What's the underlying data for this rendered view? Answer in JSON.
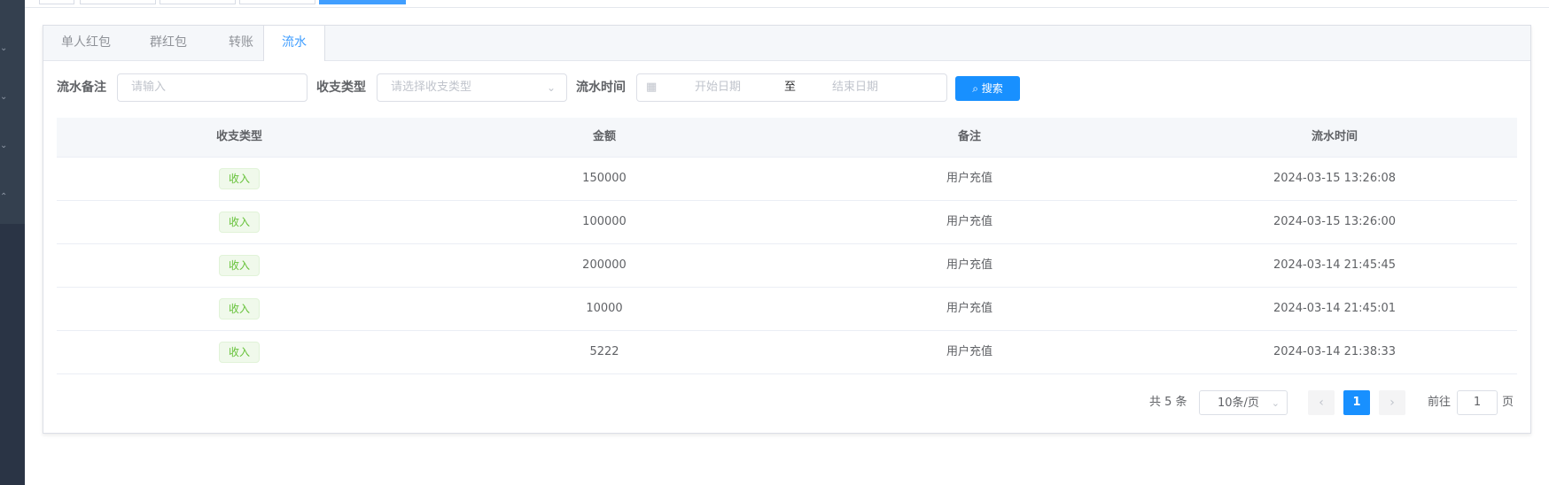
{
  "tabs": [
    "单人红包",
    "群红包",
    "转账",
    "流水"
  ],
  "filters": {
    "remark_label": "流水备注",
    "remark_placeholder": "请输入",
    "type_label": "收支类型",
    "type_placeholder": "请选择收支类型",
    "time_label": "流水时间",
    "start_placeholder": "开始日期",
    "range_separator": "至",
    "end_placeholder": "结束日期",
    "search_label": "搜索"
  },
  "table": {
    "columns": [
      "收支类型",
      "金额",
      "备注",
      "流水时间"
    ],
    "rows": [
      {
        "type": "收入",
        "amount": "150000",
        "remark": "用户充值",
        "time": "2024-03-15 13:26:08"
      },
      {
        "type": "收入",
        "amount": "100000",
        "remark": "用户充值",
        "time": "2024-03-15 13:26:00"
      },
      {
        "type": "收入",
        "amount": "200000",
        "remark": "用户充值",
        "time": "2024-03-14 21:45:45"
      },
      {
        "type": "收入",
        "amount": "10000",
        "remark": "用户充值",
        "time": "2024-03-14 21:45:01"
      },
      {
        "type": "收入",
        "amount": "5222",
        "remark": "用户充值",
        "time": "2024-03-14 21:38:33"
      }
    ]
  },
  "pagination": {
    "total": "共 5 条",
    "page_size": "10条/页",
    "current_page": "1",
    "goto_label": "前往",
    "goto_value": "1",
    "page_suffix": "页"
  },
  "colors": {
    "primary": "#1890ff",
    "income_tag": "#67c23a",
    "sidebar": "#2a3445"
  }
}
